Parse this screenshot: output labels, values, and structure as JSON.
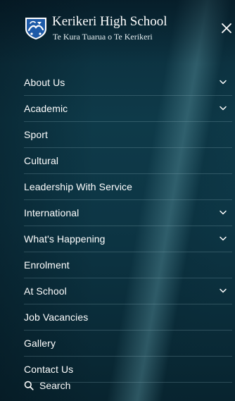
{
  "header": {
    "school_name": "Kerikeri High School",
    "subtitle": "Te Kura Tuarua o Te Kerikeri",
    "crest_icon": "school-crest-icon",
    "close_icon": "close-icon"
  },
  "menu": {
    "items": [
      {
        "label": "About Us",
        "has_submenu": true
      },
      {
        "label": "Academic",
        "has_submenu": true
      },
      {
        "label": "Sport",
        "has_submenu": false
      },
      {
        "label": "Cultural",
        "has_submenu": false
      },
      {
        "label": "Leadership With Service",
        "has_submenu": false
      },
      {
        "label": "International",
        "has_submenu": true
      },
      {
        "label": "What's Happening",
        "has_submenu": true
      },
      {
        "label": "Enrolment",
        "has_submenu": false
      },
      {
        "label": "At School",
        "has_submenu": true
      },
      {
        "label": "Job Vacancies",
        "has_submenu": false
      },
      {
        "label": "Gallery",
        "has_submenu": false
      },
      {
        "label": "Contact Us",
        "has_submenu": false
      }
    ]
  },
  "search": {
    "label": "Search",
    "icon": "search-icon"
  },
  "colors": {
    "background": "#0d3645",
    "text": "#ffffff",
    "divider": "#8cafb9",
    "crest_blue": "#1d5aa8"
  }
}
